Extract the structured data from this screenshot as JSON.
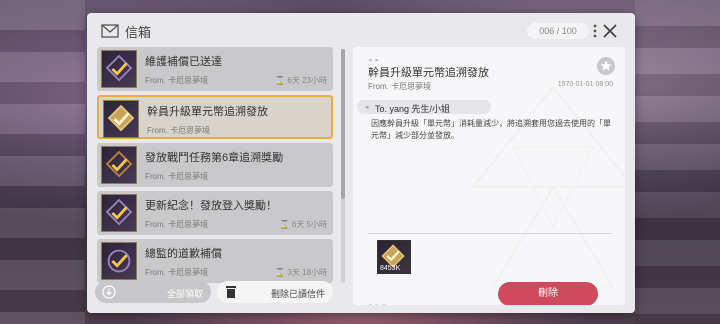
{
  "header": {
    "title": "信箱",
    "counter": "006 / 100"
  },
  "mail_list": [
    {
      "subject": "維護補償已送達",
      "from": "From. 卡厄思夢境",
      "expiry": "6天 23小時",
      "selected": false
    },
    {
      "subject": "幹員升級單元幣追溯發放",
      "from": "From. 卡厄思夢境",
      "expiry": "",
      "selected": true
    },
    {
      "subject": "發放戰鬥任務第6章追溯獎勵",
      "from": "From. 卡厄思夢境",
      "expiry": "",
      "selected": false
    },
    {
      "subject": "更新紀念！發放登入獎勵！",
      "from": "From. 卡厄思夢境",
      "expiry": "6天 5小時",
      "selected": false
    },
    {
      "subject": "總監的道歉補償",
      "from": "From. 卡厄思夢境",
      "expiry": "3天 18小時",
      "selected": false
    }
  ],
  "footer_buttons": {
    "claim_all": "全部領取",
    "delete_read": "刪除已讀信件"
  },
  "detail": {
    "subject": "幹員升級單元幣追溯發放",
    "from": "From. 卡厄思夢境",
    "date": "1970-01-01 08:00",
    "to": "To. yang 先生/小姐",
    "body": "因應幹員升級「單元幣」消耗量減少，將追溯套用您過去使用的「單元幣」減少部分並發放。",
    "attachment_qty": "8453K",
    "delete_label": "刪除"
  },
  "colors": {
    "accent_selected": "#e7ad3d",
    "delete_button": "#cf4a5d"
  }
}
